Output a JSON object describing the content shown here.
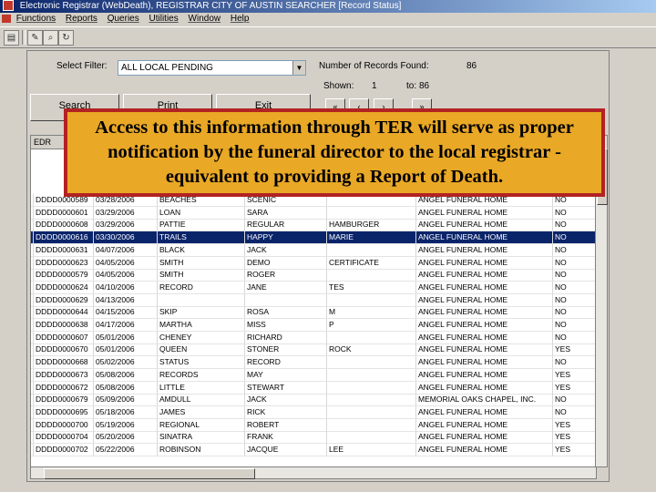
{
  "window": {
    "title": "Electronic Registrar (WebDeath), REGISTRAR CITY OF AUSTIN SEARCHER [Record Status]"
  },
  "menu": {
    "items": [
      "Functions",
      "Reports",
      "Queries",
      "Utilities",
      "Window",
      "Help"
    ]
  },
  "toolbar": {
    "icons": [
      "print-icon",
      "edit-icon",
      "search-icon",
      "refresh-icon"
    ]
  },
  "filter": {
    "label": "Select Filter:",
    "value": "ALL LOCAL PENDING"
  },
  "records": {
    "found_label": "Number of Records Found:",
    "found_value": "86",
    "shown_label": "Shown:",
    "shown_from": "1",
    "to_label": "to:",
    "shown_to": "86"
  },
  "buttons": {
    "search": "Search",
    "print": "Print",
    "exit": "Exit"
  },
  "nav": {
    "first": "«",
    "prev": "‹",
    "next": "›",
    "last": "»"
  },
  "grid": {
    "header_first": "EDR",
    "rows": [
      [
        "DDDD0000589",
        "03/28/2006",
        "BEACHES",
        "SCENIC",
        "",
        "ANGEL FUNERAL HOME",
        "NO"
      ],
      [
        "DDDD0000601",
        "03/29/2006",
        "LOAN",
        "SARA",
        "",
        "ANGEL FUNERAL HOME",
        "NO"
      ],
      [
        "DDDD0000608",
        "03/29/2006",
        "PATTIE",
        "REGULAR",
        "HAMBURGER",
        "ANGEL FUNERAL HOME",
        "NO"
      ],
      [
        "DDDD0000616",
        "03/30/2006",
        "TRAILS",
        "HAPPY",
        "MARIE",
        "ANGEL FUNERAL HOME",
        "NO"
      ],
      [
        "DDDD0000631",
        "04/07/2006",
        "BLACK",
        "JACK",
        "",
        "ANGEL FUNERAL HOME",
        "NO"
      ],
      [
        "DDDD0000623",
        "04/05/2006",
        "SMITH",
        "DEMO",
        "CERTIFICATE",
        "ANGEL FUNERAL HOME",
        "NO"
      ],
      [
        "DDDD0000579",
        "04/05/2006",
        "SMITH",
        "ROGER",
        "",
        "ANGEL FUNERAL HOME",
        "NO"
      ],
      [
        "DDDD0000624",
        "04/10/2006",
        "RECORD",
        "JANE",
        "TES",
        "ANGEL FUNERAL HOME",
        "NO"
      ],
      [
        "DDDD0000629",
        "04/13/2006",
        "",
        "",
        "",
        "ANGEL FUNERAL HOME",
        "NO"
      ],
      [
        "DDDD0000644",
        "04/15/2006",
        "SKIP",
        "ROSA",
        "M",
        "ANGEL FUNERAL HOME",
        "NO"
      ],
      [
        "DDDD0000638",
        "04/17/2006",
        "MARTHA",
        "MISS",
        "P",
        "ANGEL FUNERAL HOME",
        "NO"
      ],
      [
        "DDDD0000607",
        "05/01/2006",
        "CHENEY",
        "RICHARD",
        "",
        "ANGEL FUNERAL HOME",
        "NO"
      ],
      [
        "DDDD0000670",
        "05/01/2006",
        "QUEEN",
        "STONER",
        "ROCK",
        "ANGEL FUNERAL HOME",
        "YES"
      ],
      [
        "DDDD0000668",
        "05/02/2006",
        "STATUS",
        "RECORD",
        "",
        "ANGEL FUNERAL HOME",
        "NO"
      ],
      [
        "DDDD0000673",
        "05/08/2006",
        "RECORDS",
        "MAY",
        "",
        "ANGEL FUNERAL HOME",
        "YES"
      ],
      [
        "DDDD0000672",
        "05/08/2006",
        "LITTLE",
        "STEWART",
        "",
        "ANGEL FUNERAL HOME",
        "YES"
      ],
      [
        "DDDD0000679",
        "05/09/2006",
        "AMDULL",
        "JACK",
        "",
        "MEMORIAL OAKS CHAPEL, INC.",
        "NO"
      ],
      [
        "DDDD0000695",
        "05/18/2006",
        "JAMES",
        "RICK",
        "",
        "ANGEL FUNERAL HOME",
        "NO"
      ],
      [
        "DDDD0000700",
        "05/19/2006",
        "REGIONAL",
        "ROBERT",
        "",
        "ANGEL FUNERAL HOME",
        "YES"
      ],
      [
        "DDDD0000704",
        "05/20/2006",
        "SINATRA",
        "FRANK",
        "",
        "ANGEL FUNERAL HOME",
        "YES"
      ],
      [
        "DDDD0000702",
        "05/22/2006",
        "ROBINSON",
        "JACQUE",
        "LEE",
        "ANGEL FUNERAL HOME",
        "YES"
      ]
    ]
  },
  "callout": {
    "text": "Access to this information through TER will serve as proper notification by the funeral director to the local registrar - equivalent to providing a Report of Death."
  },
  "colors": {
    "callout_bg": "#e9a826",
    "callout_border": "#b22222",
    "selection": "#0a246a"
  }
}
